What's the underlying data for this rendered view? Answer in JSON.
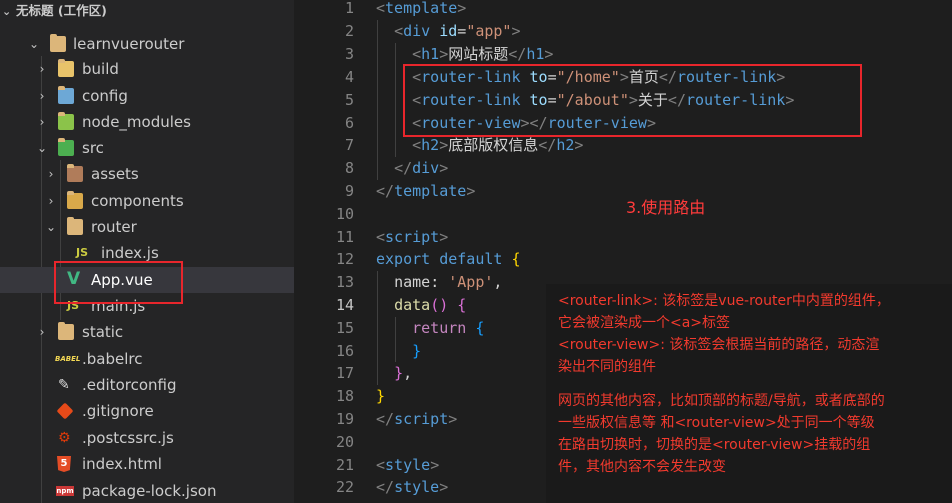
{
  "explorer": {
    "workspace_title": "无标题 (工作区)",
    "items": [
      {
        "name": "learnvuerouter",
        "icon": "folder-open-icon",
        "expanded": true
      },
      {
        "name": "build",
        "icon": "folder-build-icon"
      },
      {
        "name": "config",
        "icon": "folder-config-icon"
      },
      {
        "name": "node_modules",
        "icon": "folder-node-icon"
      },
      {
        "name": "src",
        "icon": "folder-src-icon",
        "expanded": true
      },
      {
        "name": "assets",
        "icon": "folder-assets-icon"
      },
      {
        "name": "components",
        "icon": "folder-components-icon"
      },
      {
        "name": "router",
        "icon": "folder-open-icon",
        "expanded": true
      },
      {
        "name": "index.js",
        "icon": "js-file-icon",
        "badge": "JS"
      },
      {
        "name": "App.vue",
        "icon": "vue-file-icon"
      },
      {
        "name": "main.js",
        "icon": "js-file-icon",
        "badge": "JS"
      },
      {
        "name": "static",
        "icon": "folder-static-icon"
      },
      {
        "name": ".babelrc",
        "icon": "babel-file-icon",
        "badge": "BABEL"
      },
      {
        "name": ".editorconfig",
        "icon": "editorconfig-file-icon"
      },
      {
        "name": ".gitignore",
        "icon": "git-file-icon"
      },
      {
        "name": ".postcssrc.js",
        "icon": "postcss-file-icon"
      },
      {
        "name": "index.html",
        "icon": "html-file-icon",
        "badge": "5"
      },
      {
        "name": "package-lock.json",
        "icon": "npm-file-icon",
        "badge": "npm"
      }
    ]
  },
  "editor": {
    "line_numbers": [
      "1",
      "2",
      "3",
      "4",
      "5",
      "6",
      "7",
      "8",
      "9",
      "10",
      "11",
      "12",
      "13",
      "14",
      "15",
      "16",
      "17",
      "18",
      "19",
      "20",
      "21",
      "22"
    ],
    "active_line": "14",
    "code": {
      "l1_open": "<",
      "l1_tag": "template",
      "l1_close": ">",
      "l2_open": "<",
      "l2_tag": "div",
      "l2_attr": " id",
      "l2_eq": "=",
      "l2_val": "\"app\"",
      "l2_close": ">",
      "l3_open": "<",
      "l3_tag": "h1",
      "l3_close": ">",
      "l3_text": "网站标题",
      "l3_end_open": "</",
      "l3_end_tag": "h1",
      "l3_end_close": ">",
      "l4_open": "<",
      "l4_tag": "router-link",
      "l4_attr": " to",
      "l4_eq": "=",
      "l4_val": "\"/home\"",
      "l4_close": ">",
      "l4_text": "首页",
      "l4_end_open": "</",
      "l4_end_tag": "router-link",
      "l4_end_close": ">",
      "l5_open": "<",
      "l5_tag": "router-link",
      "l5_attr": " to",
      "l5_eq": "=",
      "l5_val": "\"/about\"",
      "l5_close": ">",
      "l5_text": "关于",
      "l5_end_open": "</",
      "l5_end_tag": "router-link",
      "l5_end_close": ">",
      "l6_open": "<",
      "l6_tag": "router-view",
      "l6_close": "></",
      "l6_end_tag": "router-view",
      "l6_end_close": ">",
      "l7_open": "<",
      "l7_tag": "h2",
      "l7_close": ">",
      "l7_text": "底部版权信息",
      "l7_end_open": "</",
      "l7_end_tag": "h2",
      "l7_end_close": ">",
      "l8_open": "</",
      "l8_tag": "div",
      "l8_close": ">",
      "l9_open": "</",
      "l9_tag": "template",
      "l9_close": ">",
      "l11_open": "<",
      "l11_tag": "script",
      "l11_close": ">",
      "l12_kw1": "export",
      "l12_kw2": " default",
      "l12_brace": " {",
      "l13_prop": "name",
      "l13_colon": ": ",
      "l13_val": "'App'",
      "l13_comma": ",",
      "l14_fn": "data",
      "l14_paren": "()",
      "l14_brace": " {",
      "l15_kw": "return",
      "l15_brace": " {",
      "l16_brace": "}",
      "l17_brace": "}",
      "l17_comma": ",",
      "l18_brace": "}",
      "l19_open": "</",
      "l19_tag": "script",
      "l19_close": ">",
      "l21_open": "<",
      "l21_tag": "style",
      "l21_close": ">",
      "l22_open": "</",
      "l22_tag": "style",
      "l22_close": ">"
    }
  },
  "annotations": {
    "caption": "3.使用路由",
    "note_lines": [
      "<router-link>: 该标签是vue-router中内置的组件，",
      "它会被渲染成一个<a>标签",
      "<router-view>: 该标签会根据当前的路径，动态渲",
      "染出不同的组件",
      "网页的其他内容，比如顶部的标题/导航，或者底部的",
      "一些版权信息等 和<router-view>处于同一个等级",
      "在路由切换时，切换的是<router-view>挂载的组",
      "件，其他内容不会发生改变"
    ]
  },
  "colors": {
    "annotation_red": "#e8262c",
    "tag_blue": "#569cd6",
    "string_orange": "#ce9178"
  }
}
